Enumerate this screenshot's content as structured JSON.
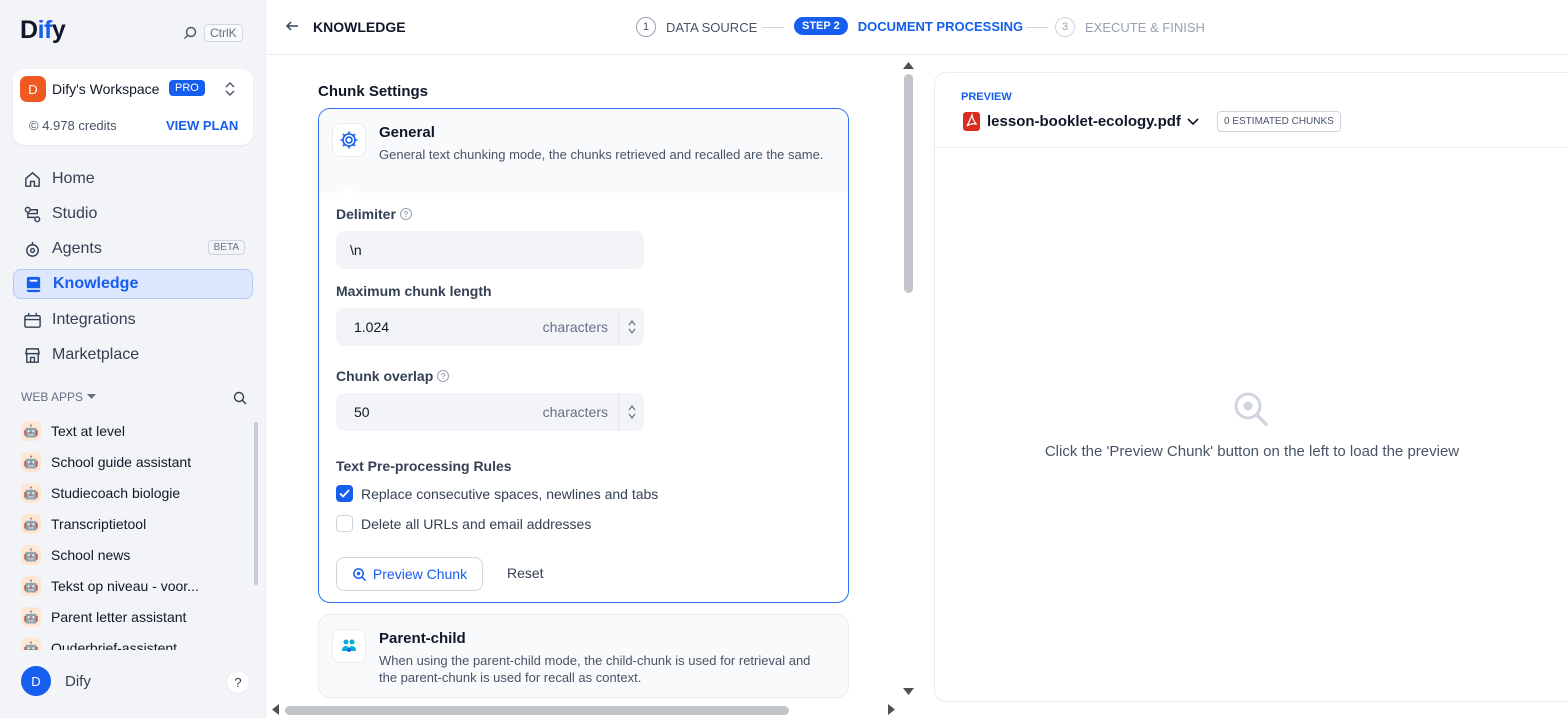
{
  "app": {
    "logo_prefix": "D",
    "logo_highlight": "if",
    "logo_suffix": "y",
    "shortcut": "CtrlK"
  },
  "workspace": {
    "avatar": "D",
    "name": "Dify's Workspace",
    "plan_badge": "PRO",
    "credits": "4.978 credits",
    "view_plan": "VIEW PLAN"
  },
  "nav": [
    {
      "label": "Home",
      "icon": "home-icon"
    },
    {
      "label": "Studio",
      "icon": "studio-icon"
    },
    {
      "label": "Agents",
      "icon": "agents-icon",
      "badge": "BETA"
    },
    {
      "label": "Knowledge",
      "icon": "knowledge-icon",
      "active": true
    },
    {
      "label": "Integrations",
      "icon": "integrations-icon"
    },
    {
      "label": "Marketplace",
      "icon": "marketplace-icon"
    }
  ],
  "web_apps": {
    "header": "WEB APPS",
    "items": [
      "Text at level",
      "School guide assistant",
      "Studiecoach biologie",
      "Transcriptietool",
      "School news",
      "Tekst op niveau - voor...",
      "Parent letter assistant",
      "Ouderbrief-assistent"
    ]
  },
  "user": {
    "avatar": "D",
    "name": "Dify",
    "help": "?"
  },
  "topbar": {
    "title": "KNOWLEDGE",
    "steps": [
      {
        "num": "1",
        "label": "DATA SOURCE",
        "state": "done"
      },
      {
        "num": "STEP 2",
        "label": "DOCUMENT PROCESSING",
        "state": "active"
      },
      {
        "num": "3",
        "label": "EXECUTE & FINISH",
        "state": "pending"
      }
    ]
  },
  "chunk_settings": {
    "title": "Chunk Settings",
    "general": {
      "title": "General",
      "description": "General text chunking mode, the chunks retrieved and recalled are the same."
    },
    "delimiter": {
      "label": "Delimiter",
      "value": "\\n"
    },
    "max_length": {
      "label": "Maximum chunk length",
      "value": "1.024",
      "unit": "characters"
    },
    "overlap": {
      "label": "Chunk overlap",
      "value": "50",
      "unit": "characters"
    },
    "rules": {
      "title": "Text Pre-processing Rules",
      "items": [
        {
          "label": "Replace consecutive spaces, newlines and tabs",
          "checked": true
        },
        {
          "label": "Delete all URLs and email addresses",
          "checked": false
        }
      ]
    },
    "preview_button": "Preview Chunk",
    "reset_button": "Reset",
    "parent_child": {
      "title": "Parent-child",
      "description": "When using the parent-child mode, the child-chunk is used for retrieval and the parent-chunk is used for recall as context."
    }
  },
  "preview": {
    "label": "PREVIEW",
    "file": "lesson-booklet-ecology.pdf",
    "chunks": "0 ESTIMATED CHUNKS",
    "empty_text": "Click the 'Preview Chunk' button on the left to load the preview"
  },
  "colors": {
    "accent": "#155eef",
    "active_nav_bg": "#dde7fd",
    "workspace_avatar": "#f05a22",
    "pdf": "#d92d20"
  }
}
